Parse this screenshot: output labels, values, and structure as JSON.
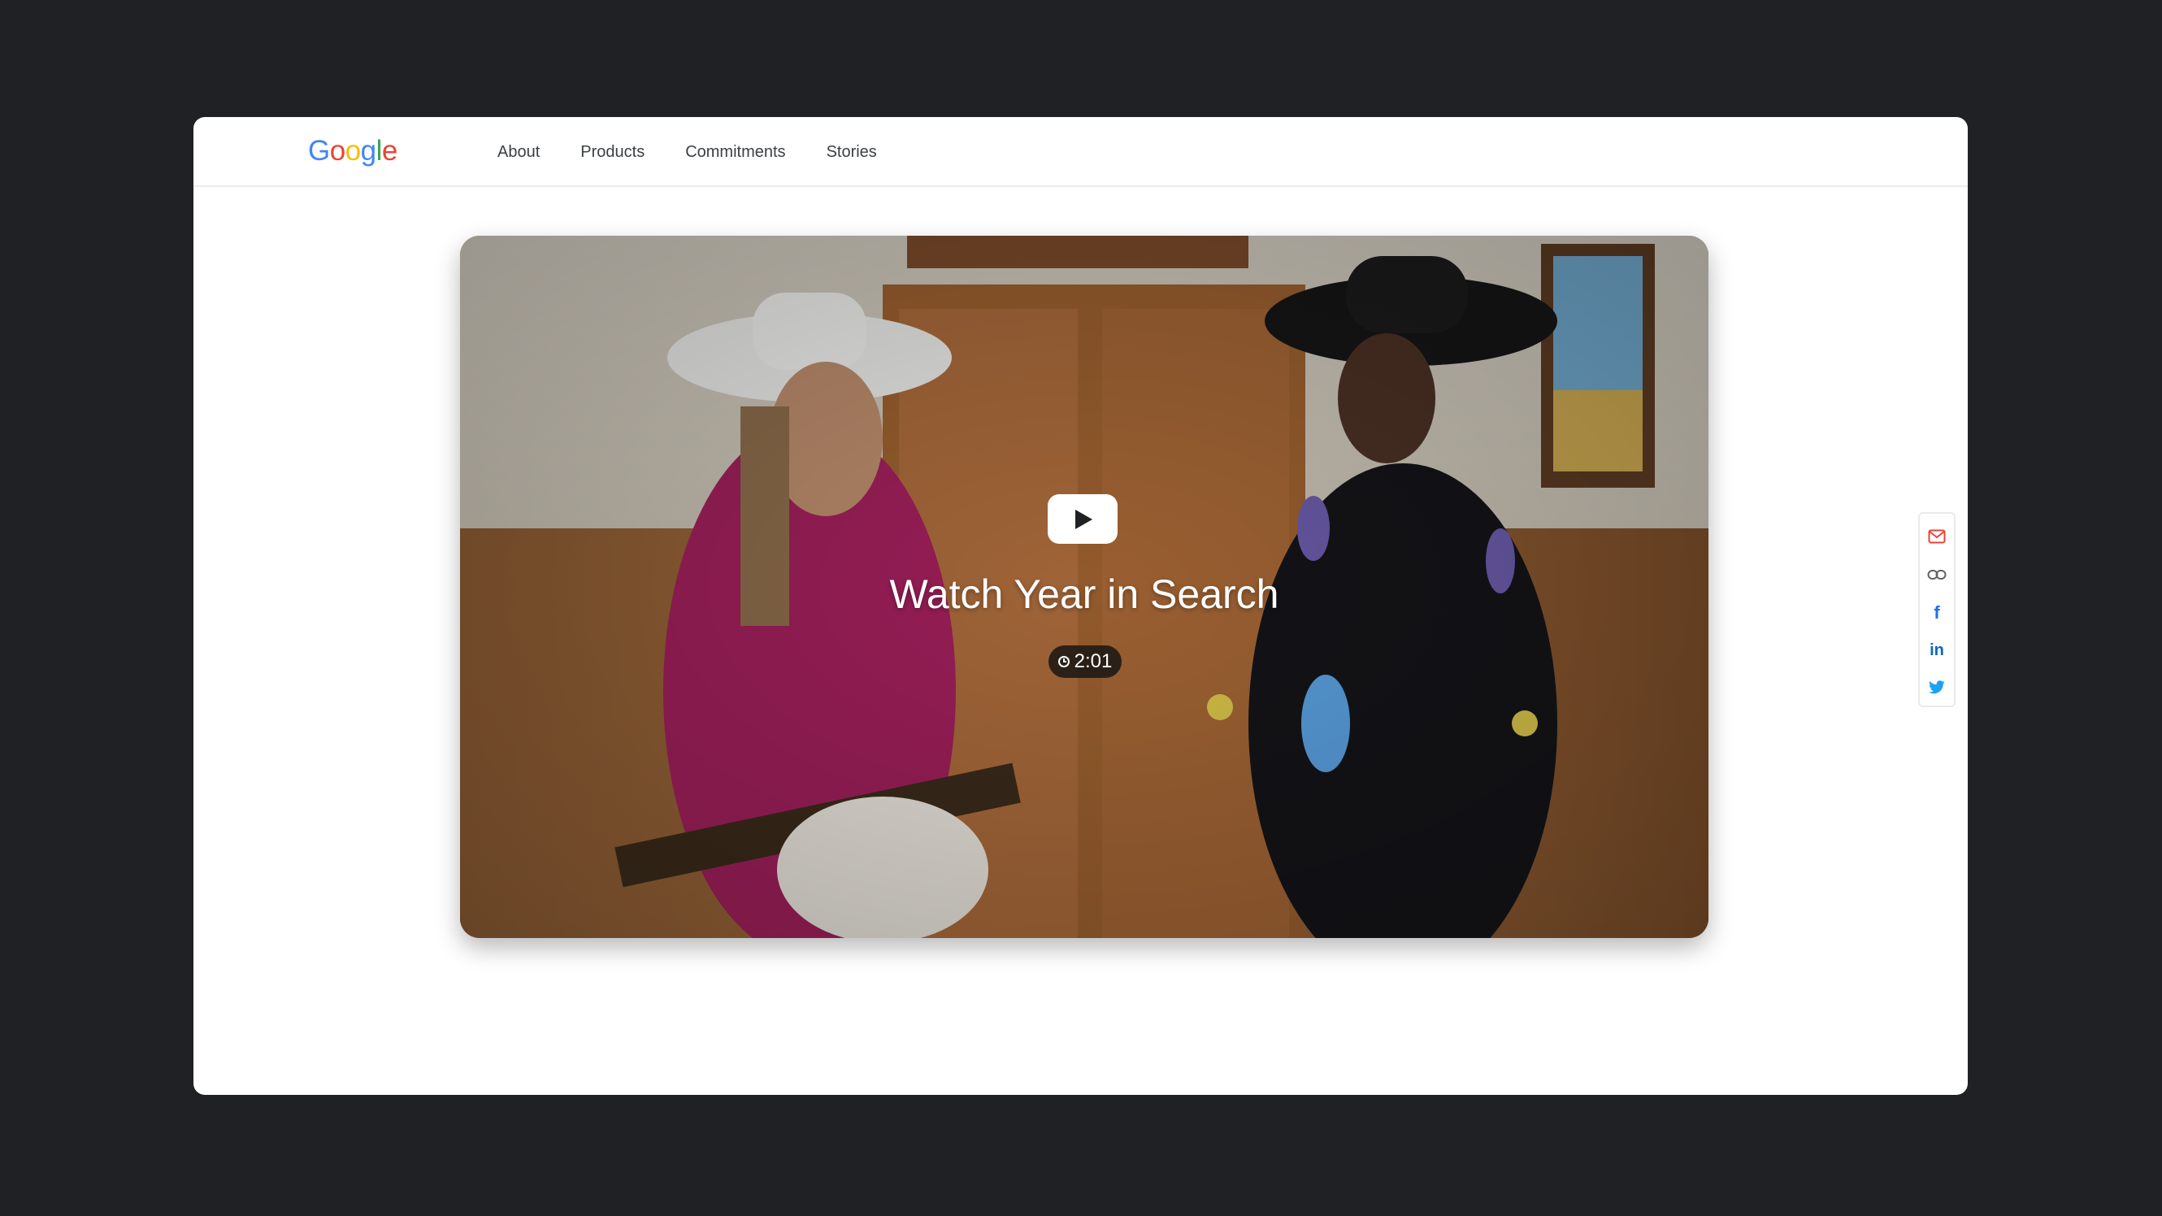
{
  "header": {
    "logo_letters": [
      {
        "char": "G",
        "color": "#4285F4"
      },
      {
        "char": "o",
        "color": "#EA4335"
      },
      {
        "char": "o",
        "color": "#FBBC05"
      },
      {
        "char": "g",
        "color": "#4285F4"
      },
      {
        "char": "l",
        "color": "#34A853"
      },
      {
        "char": "e",
        "color": "#EA4335"
      }
    ],
    "nav": [
      {
        "label": "About"
      },
      {
        "label": "Products"
      },
      {
        "label": "Commitments"
      },
      {
        "label": "Stories"
      }
    ]
  },
  "hero": {
    "title": "Watch Year in Search",
    "duration": "2:01",
    "play_icon": "play-icon",
    "clock_icon": "clock-icon"
  },
  "share": {
    "items": [
      {
        "icon": "email-icon",
        "color": "#EA4335"
      },
      {
        "icon": "link-icon",
        "color": "#5f6368"
      },
      {
        "icon": "facebook-icon",
        "color": "#1a73e8"
      },
      {
        "icon": "linkedin-icon",
        "color": "#0a66c2"
      },
      {
        "icon": "twitter-icon",
        "color": "#1da1f2"
      }
    ]
  }
}
